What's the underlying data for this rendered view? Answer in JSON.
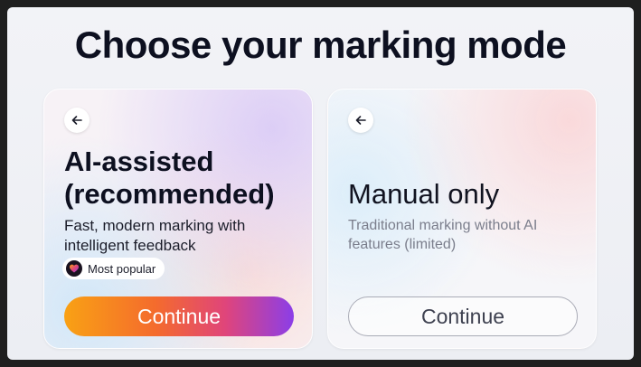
{
  "page": {
    "title": "Choose your marking mode"
  },
  "cards": {
    "ai": {
      "heading_line1": "AI-assisted",
      "heading_line2": "(recommended)",
      "description": "Fast, modern marking with intelligent feedback",
      "badge": "Most popular",
      "button": "Continue",
      "back_icon": "arrow-left-icon"
    },
    "manual": {
      "heading": "Manual only",
      "description": "Traditional marking without AI features (limited)",
      "button": "Continue",
      "back_icon": "arrow-left-icon"
    }
  },
  "colors": {
    "title": "#0d1020",
    "gradient_start": "#f9a114",
    "gradient_end": "#8b3ee8",
    "outline": "#a9abb6"
  }
}
